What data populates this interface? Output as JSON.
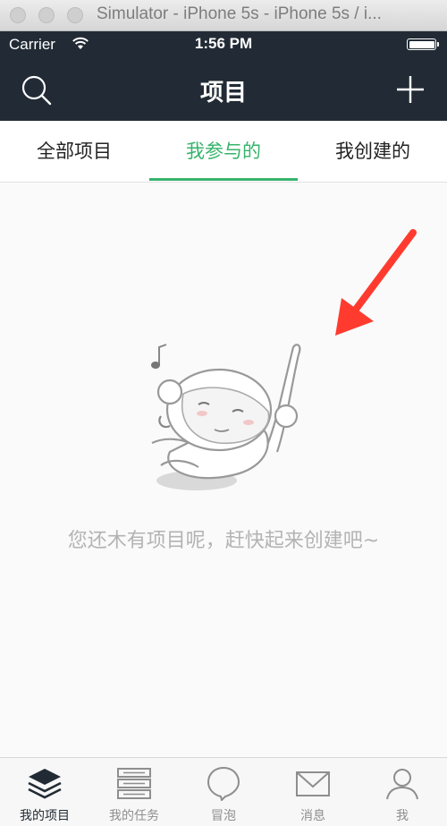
{
  "window": {
    "title": "Simulator - iPhone 5s - iPhone 5s / i..."
  },
  "status_bar": {
    "carrier": "Carrier",
    "time": "1:56 PM"
  },
  "nav": {
    "title": "项目",
    "left_icon": "search-icon",
    "right_icon": "add-icon"
  },
  "tabs": [
    {
      "label": "全部项目",
      "active": false
    },
    {
      "label": "我参与的",
      "active": true
    },
    {
      "label": "我创建的",
      "active": false
    }
  ],
  "empty_state": {
    "message": "您还木有项目呢，赶快起来创建吧~"
  },
  "tab_bar": [
    {
      "label": "我的项目",
      "icon": "layers-icon",
      "active": true
    },
    {
      "label": "我的任务",
      "icon": "task-list-icon",
      "active": false
    },
    {
      "label": "冒泡",
      "icon": "bubble-icon",
      "active": false
    },
    {
      "label": "消息",
      "icon": "mail-icon",
      "active": false
    },
    {
      "label": "我",
      "icon": "user-icon",
      "active": false
    }
  ],
  "colors": {
    "nav_background": "#222b35",
    "accent": "#37b36c",
    "annotation_arrow": "#ff3b30"
  }
}
